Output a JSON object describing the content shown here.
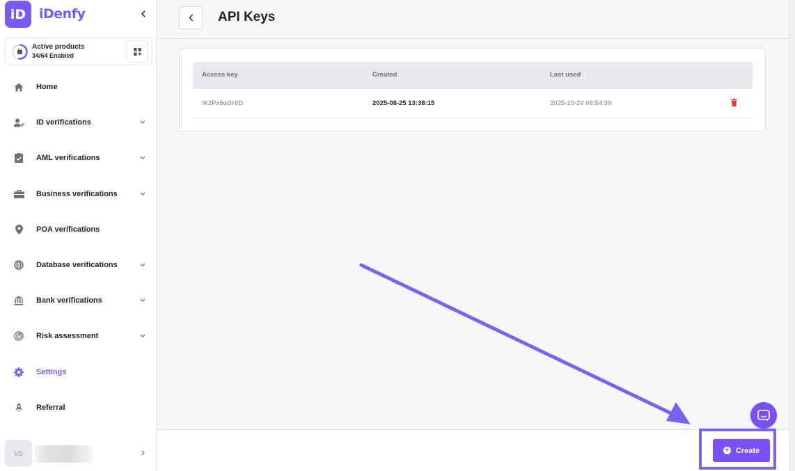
{
  "brand": {
    "logo_mark": "iD",
    "name": "iDenfy",
    "accent": "#7a5af5"
  },
  "sidebar": {
    "products": {
      "title": "Active products",
      "status": "34/64 Enabled"
    },
    "items": [
      {
        "label": "Home",
        "icon": "home-icon",
        "chevron": false,
        "active": false
      },
      {
        "label": "ID verifications",
        "icon": "user-check-icon",
        "chevron": true,
        "active": false
      },
      {
        "label": "AML verifications",
        "icon": "clipboard-check-icon",
        "chevron": true,
        "active": false
      },
      {
        "label": "Business verifications",
        "icon": "briefcase-icon",
        "chevron": true,
        "active": false
      },
      {
        "label": "POA verifications",
        "icon": "map-pin-icon",
        "chevron": false,
        "active": false
      },
      {
        "label": "Database verifications",
        "icon": "globe-icon",
        "chevron": true,
        "active": false
      },
      {
        "label": "Bank verifications",
        "icon": "bank-icon",
        "chevron": true,
        "active": false
      },
      {
        "label": "Risk assessment",
        "icon": "target-icon",
        "chevron": true,
        "active": false
      },
      {
        "label": "Settings",
        "icon": "gear-icon",
        "chevron": false,
        "active": true
      },
      {
        "label": "Referral",
        "icon": "rocket-icon",
        "chevron": false,
        "active": false
      }
    ],
    "user": {
      "initials": "VD"
    }
  },
  "header": {
    "title": "API Keys"
  },
  "table": {
    "columns": [
      "Access key",
      "Created",
      "Last used"
    ],
    "rows": [
      {
        "access_key": "IK2Px5w3HfD",
        "created": "2025-08-25 13:38:15",
        "last_used": "2025-10-24 06:54:39"
      }
    ]
  },
  "footer": {
    "create_label": "Create"
  },
  "colors": {
    "primary": "#7a4ff5",
    "danger": "#e53935",
    "annotation": "#7b61f2"
  }
}
